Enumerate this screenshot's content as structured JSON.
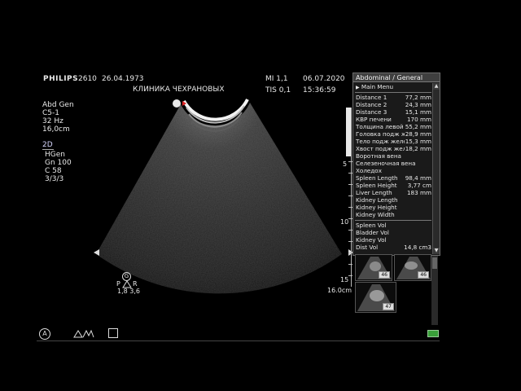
{
  "header": {
    "brand": "PHILIPS",
    "patient_id": "2610",
    "birth_date": "26.04.1973",
    "clinic": "КЛИНИКА ЧЕХРАНОВЫХ",
    "mi": "MI 1,1",
    "tis": "TIS 0,1",
    "date": "06.07.2020",
    "time": "15:36:59"
  },
  "params": {
    "preset": "Abd Gen",
    "probe": "C5-1",
    "frame_rate": "32 Hz",
    "depth": "16,0cm"
  },
  "mode": {
    "title": "2D",
    "hgen": "HGen",
    "gain": "Gn 100",
    "compression": "C 58",
    "persistence": "3/3/3"
  },
  "depth_scale": {
    "ticks": [
      "5",
      "10",
      "15"
    ],
    "depth_label": "16.0cm"
  },
  "orientation": {
    "g_label": "G",
    "p_label": "P",
    "r_label": "R",
    "values": "1,8 3,6"
  },
  "panel": {
    "title": "Abdominal / General",
    "main_menu": "Main Menu",
    "measurements": [
      {
        "label": "Distance 1",
        "value": "77,2 mm"
      },
      {
        "label": "Distance 2",
        "value": "24,3 mm"
      },
      {
        "label": "Distance 3",
        "value": "15,1 mm"
      },
      {
        "label": "КВР печени",
        "value": "170 mm"
      },
      {
        "label": "Толщина левой д",
        "value": "55,2 mm"
      },
      {
        "label": "Головка подж же",
        "value": "28,9 mm"
      },
      {
        "label": "Тело подж желе",
        "value": "15,3 mm"
      },
      {
        "label": "Хвост подж желе",
        "value": "18,2 mm"
      },
      {
        "label": "Воротная вена",
        "value": ""
      },
      {
        "label": "Селезеночная вена",
        "value": ""
      },
      {
        "label": "Холедох",
        "value": ""
      },
      {
        "label": "Spleen Length",
        "value": "98,4 mm"
      },
      {
        "label": "Spleen Height",
        "value": "3,77 cm"
      },
      {
        "label": "Liver Length",
        "value": "183 mm"
      },
      {
        "label": "Kidney Length",
        "value": ""
      },
      {
        "label": "Kidney Height",
        "value": ""
      },
      {
        "label": "Kidney Width",
        "value": ""
      }
    ],
    "volumes": [
      {
        "label": "Spleen Vol",
        "value": ""
      },
      {
        "label": "Bladder Vol",
        "value": ""
      },
      {
        "label": "Kidney Vol",
        "value": ""
      },
      {
        "label": "Dist Vol",
        "value": "14,8 cm3"
      }
    ]
  },
  "thumbnails": [
    {
      "tag": "46"
    },
    {
      "tag": "46"
    },
    {
      "tag": "47"
    }
  ],
  "icons": {
    "scroll_up": "▲",
    "scroll_down": "▼",
    "main_menu_arrow": "▶",
    "annotation": "A"
  }
}
